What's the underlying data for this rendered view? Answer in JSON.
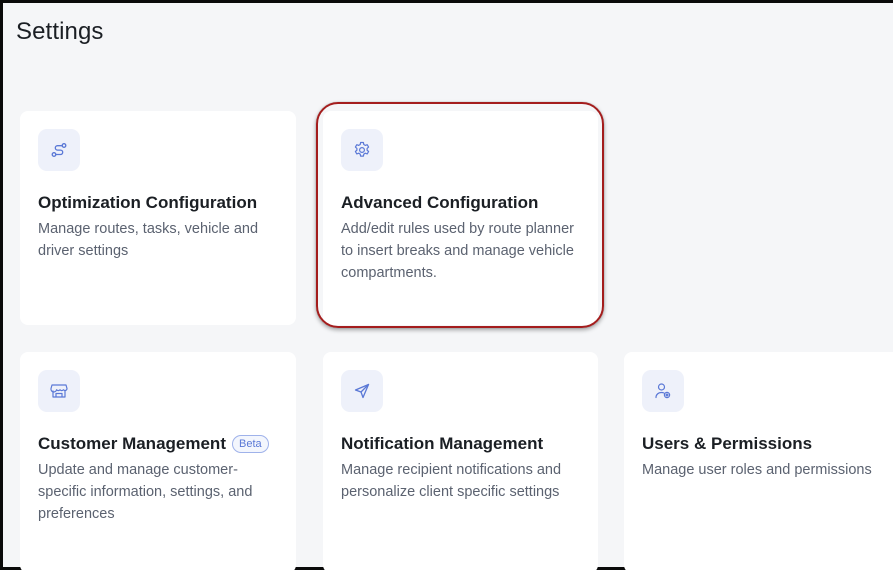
{
  "page": {
    "title": "Settings"
  },
  "cards": [
    {
      "icon": "route-icon",
      "title": "Optimization Configuration",
      "description": "Manage routes, tasks, vehicle and driver settings"
    },
    {
      "icon": "gear-icon",
      "title": "Advanced Configuration",
      "description": "Add/edit rules used by route planner to insert breaks and manage vehicle compartments."
    },
    {
      "icon": "store-icon",
      "title": "Customer Management",
      "badge": "Beta",
      "description": "Update and manage customer-specific information, settings, and preferences"
    },
    {
      "icon": "send-icon",
      "title": "Notification Management",
      "description": "Manage recipient notifications and personalize client specific settings"
    },
    {
      "icon": "user-gear-icon",
      "title": "Users & Permissions",
      "description": "Manage user roles and permissions"
    }
  ],
  "colors": {
    "accent": "#5a78d6",
    "highlight": "#a41d1d",
    "background": "#f5f6f8",
    "card": "#ffffff"
  }
}
